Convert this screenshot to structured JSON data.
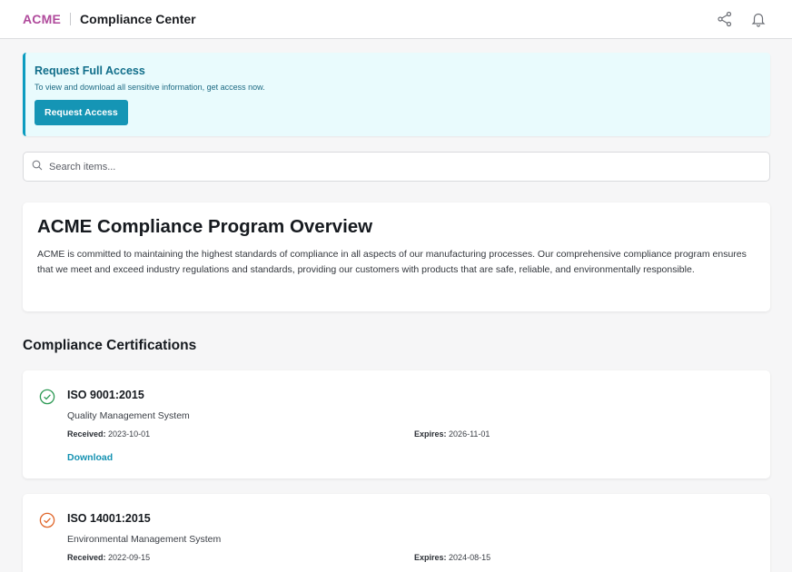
{
  "header": {
    "logo": "ACME",
    "title": "Compliance Center",
    "icons": [
      "share-icon",
      "bell-icon"
    ]
  },
  "banner": {
    "title": "Request Full Access",
    "text": "To view and download all sensitive information, get access now.",
    "button": "Request Access"
  },
  "search": {
    "placeholder": "Search items..."
  },
  "overview": {
    "title": "ACME Compliance Program Overview",
    "body": "ACME is committed to maintaining the highest standards of compliance in all aspects of our manufacturing processes. Our comprehensive compliance program ensures that we meet and exceed industry regulations and standards, providing our customers with products that are safe, reliable, and environmentally responsible."
  },
  "certifications": {
    "title": "Compliance Certifications",
    "received_label": "Received:",
    "expires_label": "Expires:",
    "items": [
      {
        "name": "ISO 9001:2015",
        "description": "Quality Management System",
        "received": "2023-10-01",
        "expires": "2026-11-01",
        "download": "Download",
        "status_icon": "check-circle-icon",
        "status_color": "#2e9a55"
      },
      {
        "name": "ISO 14001:2015",
        "description": "Environmental Management System",
        "received": "2022-09-15",
        "expires": "2024-08-15",
        "status_icon": "check-circle-icon",
        "status_color": "#e0662a"
      }
    ]
  },
  "colors": {
    "accent": "#1595b5",
    "logo": "#b04a9c",
    "banner_bg": "#e9fbfd"
  }
}
